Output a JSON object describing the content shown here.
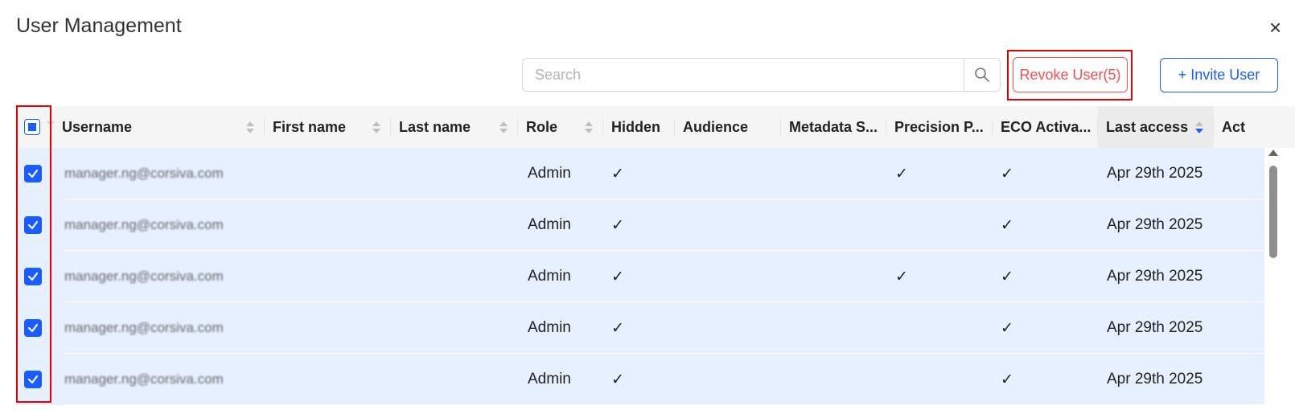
{
  "dialog": {
    "title": "User Management",
    "close_label": "×"
  },
  "toolbar": {
    "search_placeholder": "Search",
    "search_value": "",
    "revoke_label": "Revoke User(5)",
    "invite_label": "+ Invite User"
  },
  "table": {
    "columns": [
      "Username",
      "First name",
      "Last name",
      "Role",
      "Hidden",
      "Audience",
      "Metadata S...",
      "Precision P...",
      "ECO Activa...",
      "Last access",
      "Act"
    ],
    "sorted_column": "Last access",
    "check_mark": "✓",
    "rows": [
      {
        "username": "manager.ng@corsiva.com",
        "first_name": "",
        "last_name": "",
        "role": "Admin",
        "hidden": true,
        "audience": "",
        "metadata": "",
        "precision": true,
        "eco": true,
        "last_access": "Apr 29th 2025",
        "checked": true
      },
      {
        "username": "manager.ng@corsiva.com",
        "first_name": "",
        "last_name": "",
        "role": "Admin",
        "hidden": true,
        "audience": "",
        "metadata": "",
        "precision": false,
        "eco": true,
        "last_access": "Apr 29th 2025",
        "checked": true
      },
      {
        "username": "manager.ng@corsiva.com",
        "first_name": "",
        "last_name": "",
        "role": "Admin",
        "hidden": true,
        "audience": "",
        "metadata": "",
        "precision": true,
        "eco": true,
        "last_access": "Apr 29th 2025",
        "checked": true
      },
      {
        "username": "manager.ng@corsiva.com",
        "first_name": "",
        "last_name": "",
        "role": "Admin",
        "hidden": true,
        "audience": "",
        "metadata": "",
        "precision": false,
        "eco": true,
        "last_access": "Apr 29th 2025",
        "checked": true
      },
      {
        "username": "manager.ng@corsiva.com",
        "first_name": "",
        "last_name": "",
        "role": "Admin",
        "hidden": true,
        "audience": "",
        "metadata": "",
        "precision": false,
        "eco": true,
        "last_access": "Apr 29th 2025",
        "checked": true
      }
    ]
  },
  "colors": {
    "primary": "#1a5cff",
    "danger": "#ff4d4f",
    "highlight_frame": "#e60000",
    "selected_row": "#e6f0ff",
    "header_bg": "#f5f5f5"
  },
  "icons": [
    "close-icon",
    "search-icon",
    "sort-icon",
    "chevron-down-icon",
    "checkbox-checked-icon",
    "scroll-up-icon"
  ]
}
